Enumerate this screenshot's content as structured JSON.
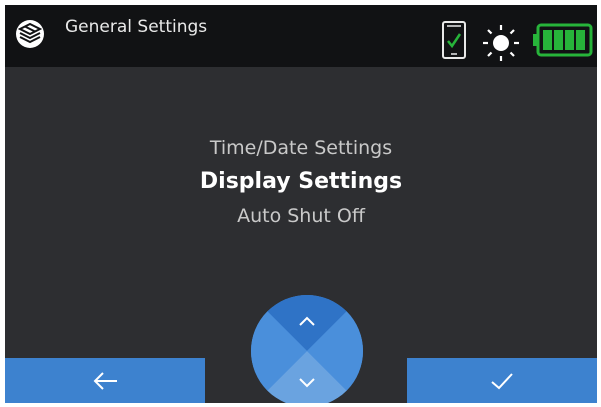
{
  "header": {
    "title": "General Settings",
    "icons": [
      "logo-icon",
      "phone-connected-icon",
      "brightness-icon",
      "battery-full-icon"
    ]
  },
  "menu": {
    "items": [
      {
        "label": "Time/Date Settings",
        "selected": false
      },
      {
        "label": "Display Settings",
        "selected": true
      },
      {
        "label": "Auto Shut Off",
        "selected": false
      }
    ]
  },
  "footer": {
    "back_icon": "arrow-left-icon",
    "ok_icon": "checkmark-icon",
    "nav_icons": [
      "chevron-up-icon",
      "chevron-down-icon"
    ]
  },
  "colors": {
    "accent": "#3d82cf",
    "header_bg": "#111214",
    "screen_bg": "#2d2e31",
    "battery": "#27b43a",
    "check": "#27b43a"
  }
}
